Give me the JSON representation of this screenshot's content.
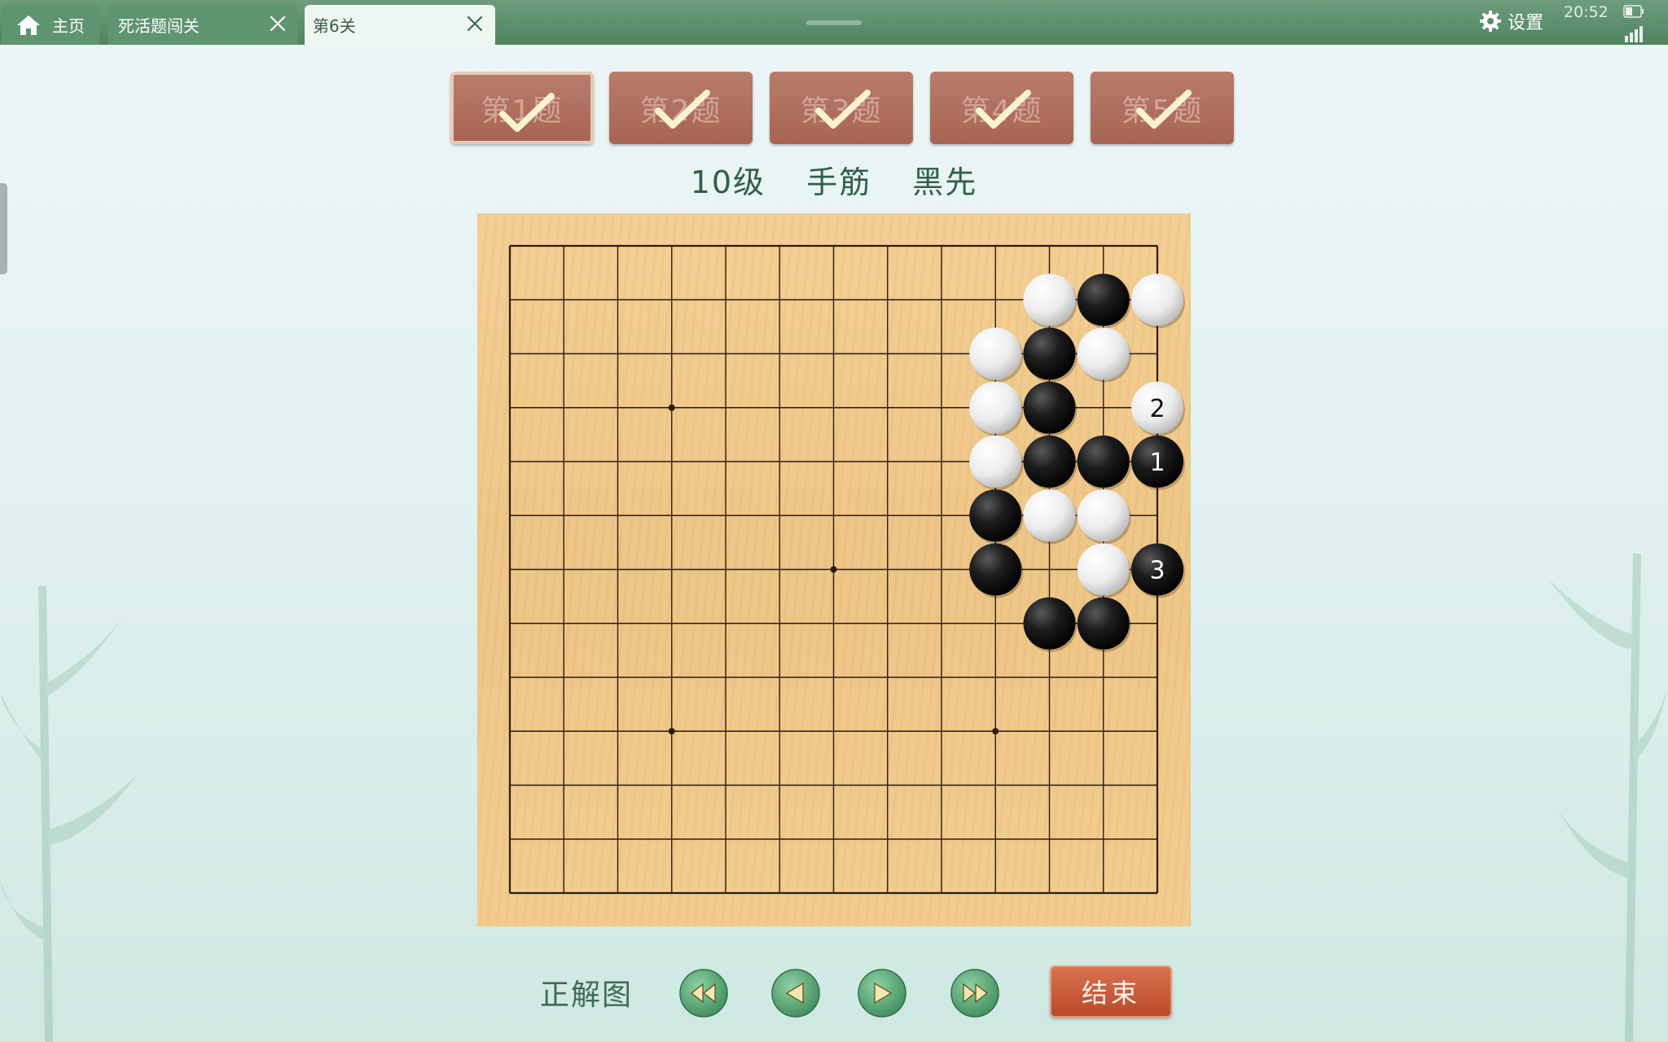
{
  "tabs": {
    "home": "主页",
    "levels": "死活题闯关",
    "current": "第6关"
  },
  "status": {
    "settings_label": "设置",
    "time": "20:52"
  },
  "problems": [
    {
      "label": "第1题",
      "solved": true,
      "active": true
    },
    {
      "label": "第2题",
      "solved": true,
      "active": false
    },
    {
      "label": "第3题",
      "solved": true,
      "active": false
    },
    {
      "label": "第4题",
      "solved": true,
      "active": false
    },
    {
      "label": "第5题",
      "solved": true,
      "active": false
    }
  ],
  "subtitle": {
    "level": "10级",
    "category": "手筋",
    "turn": "黑先"
  },
  "board": {
    "size": 13,
    "star_points": [
      [
        3,
        3
      ],
      [
        3,
        9
      ],
      [
        6,
        6
      ],
      [
        9,
        3
      ],
      [
        9,
        9
      ]
    ],
    "stones": [
      {
        "col": 10,
        "row": 1,
        "color": "white"
      },
      {
        "col": 11,
        "row": 1,
        "color": "black"
      },
      {
        "col": 12,
        "row": 1,
        "color": "white"
      },
      {
        "col": 9,
        "row": 2,
        "color": "white"
      },
      {
        "col": 10,
        "row": 2,
        "color": "black"
      },
      {
        "col": 11,
        "row": 2,
        "color": "white"
      },
      {
        "col": 9,
        "row": 3,
        "color": "white"
      },
      {
        "col": 10,
        "row": 3,
        "color": "black"
      },
      {
        "col": 12,
        "row": 3,
        "color": "white",
        "label": "2"
      },
      {
        "col": 9,
        "row": 4,
        "color": "white"
      },
      {
        "col": 10,
        "row": 4,
        "color": "black"
      },
      {
        "col": 11,
        "row": 4,
        "color": "black"
      },
      {
        "col": 12,
        "row": 4,
        "color": "black",
        "label": "1"
      },
      {
        "col": 9,
        "row": 5,
        "color": "black"
      },
      {
        "col": 10,
        "row": 5,
        "color": "white"
      },
      {
        "col": 11,
        "row": 5,
        "color": "white"
      },
      {
        "col": 9,
        "row": 6,
        "color": "black"
      },
      {
        "col": 11,
        "row": 6,
        "color": "white"
      },
      {
        "col": 12,
        "row": 6,
        "color": "black",
        "label": "3"
      },
      {
        "col": 10,
        "row": 7,
        "color": "black"
      },
      {
        "col": 11,
        "row": 7,
        "color": "black"
      }
    ]
  },
  "controls": {
    "solution_label": "正解图",
    "end_label": "结束"
  }
}
